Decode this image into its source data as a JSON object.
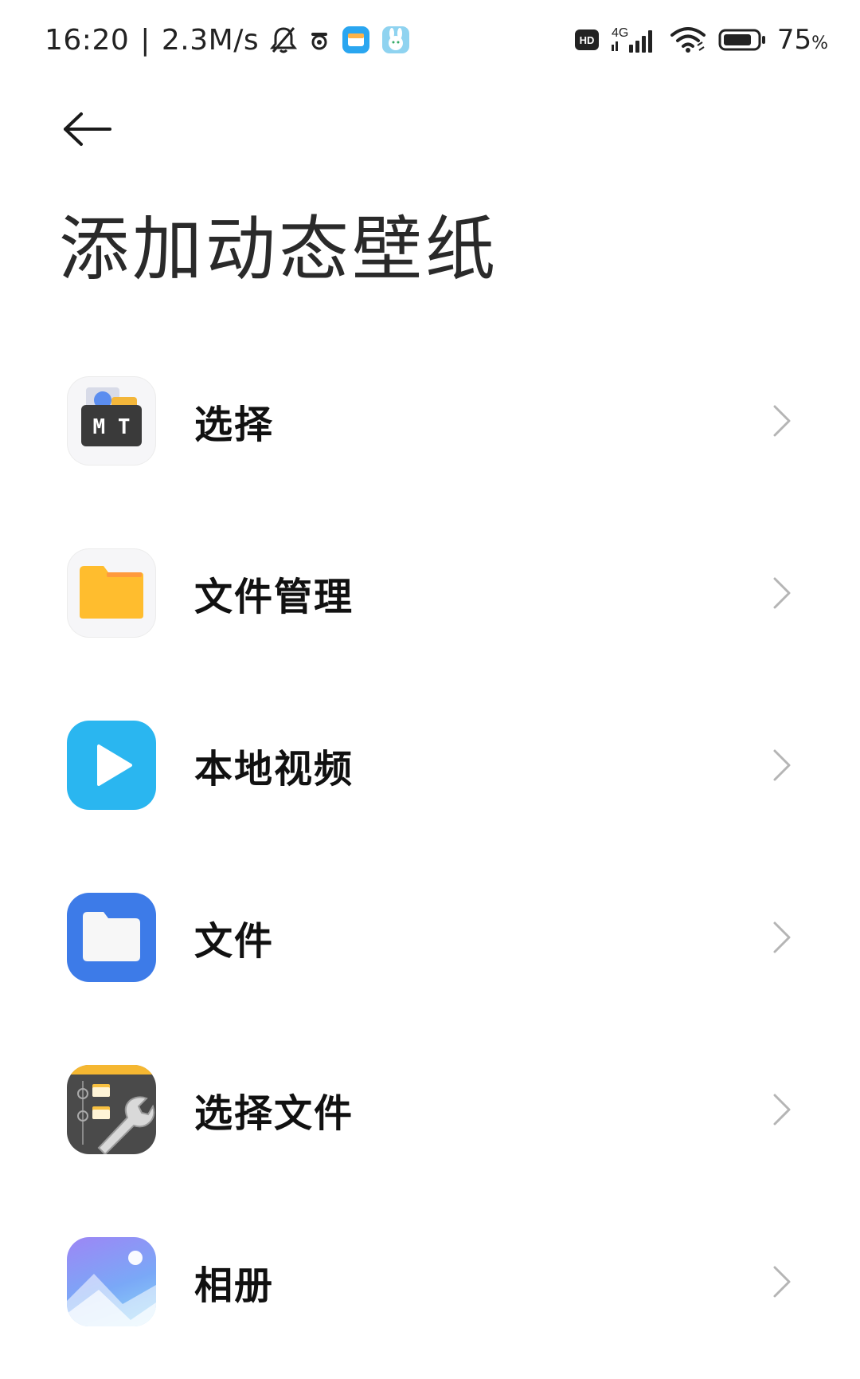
{
  "status_bar": {
    "time": "16:20",
    "separator": "|",
    "net_speed": "2.3M/s",
    "hd_label": "HD",
    "network_type": "4G",
    "battery_percent": "75",
    "percent_sign": "%",
    "icons": [
      "bell-off-icon",
      "app-notification-icon",
      "wallet-app-icon",
      "bunny-app-icon",
      "hd-icon",
      "signal-icon",
      "wifi-icon",
      "battery-icon"
    ]
  },
  "header": {
    "back_icon": "back-arrow-icon",
    "title": "添加动态壁纸"
  },
  "apps": [
    {
      "label": "选择",
      "icon": "mt-manager-icon"
    },
    {
      "label": "文件管理",
      "icon": "file-manager-folder-icon"
    },
    {
      "label": "本地视频",
      "icon": "video-play-icon"
    },
    {
      "label": "文件",
      "icon": "files-folder-icon"
    },
    {
      "label": "选择文件",
      "icon": "file-tools-wrench-icon"
    },
    {
      "label": "相册",
      "icon": "gallery-mountain-icon"
    }
  ],
  "colors": {
    "video_blue": "#2ab6f0",
    "files_blue": "#3d7be8",
    "folder_yellow": "#ffbd2e",
    "gallery_purple": "#8b8ff7"
  }
}
